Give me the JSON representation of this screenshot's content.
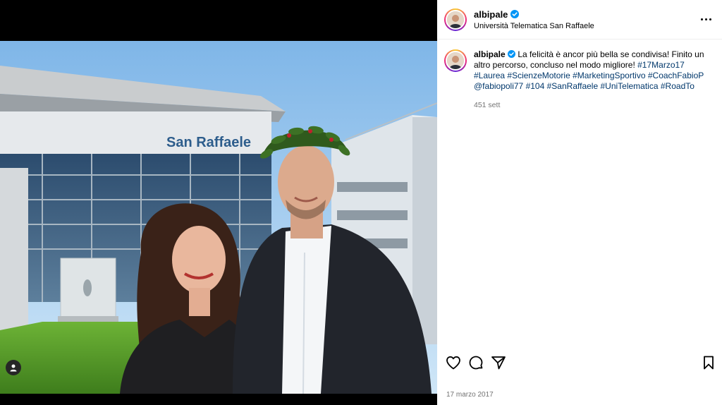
{
  "post": {
    "username": "albipale",
    "location": "Università Telematica San Raffaele",
    "caption_text": "La felicità è ancor più bella se condivisa! Finito un altro percorso, concluso nel modo migliore!",
    "hashtags": [
      "#17Marzo17",
      "#Laurea",
      "#ScienzeMotorie",
      "#MarketingSportivo",
      "#CoachFabioP",
      "@fabiopoli77",
      "#104",
      "#SanRaffaele",
      "#UniTelematica",
      "#RoadTo"
    ],
    "caption_age": "451 sett",
    "date": "17 marzo 2017"
  },
  "photo": {
    "building_sign": "San Raffaele"
  },
  "icons": {
    "verified": "verified-badge-icon",
    "more": "more-options-icon",
    "like": "heart-icon",
    "comment": "comment-icon",
    "share": "paper-plane-icon",
    "save": "bookmark-icon",
    "tags": "user-tag-icon"
  },
  "colors": {
    "verified_blue": "#0095f6",
    "link": "#00376b",
    "muted": "#737373"
  }
}
